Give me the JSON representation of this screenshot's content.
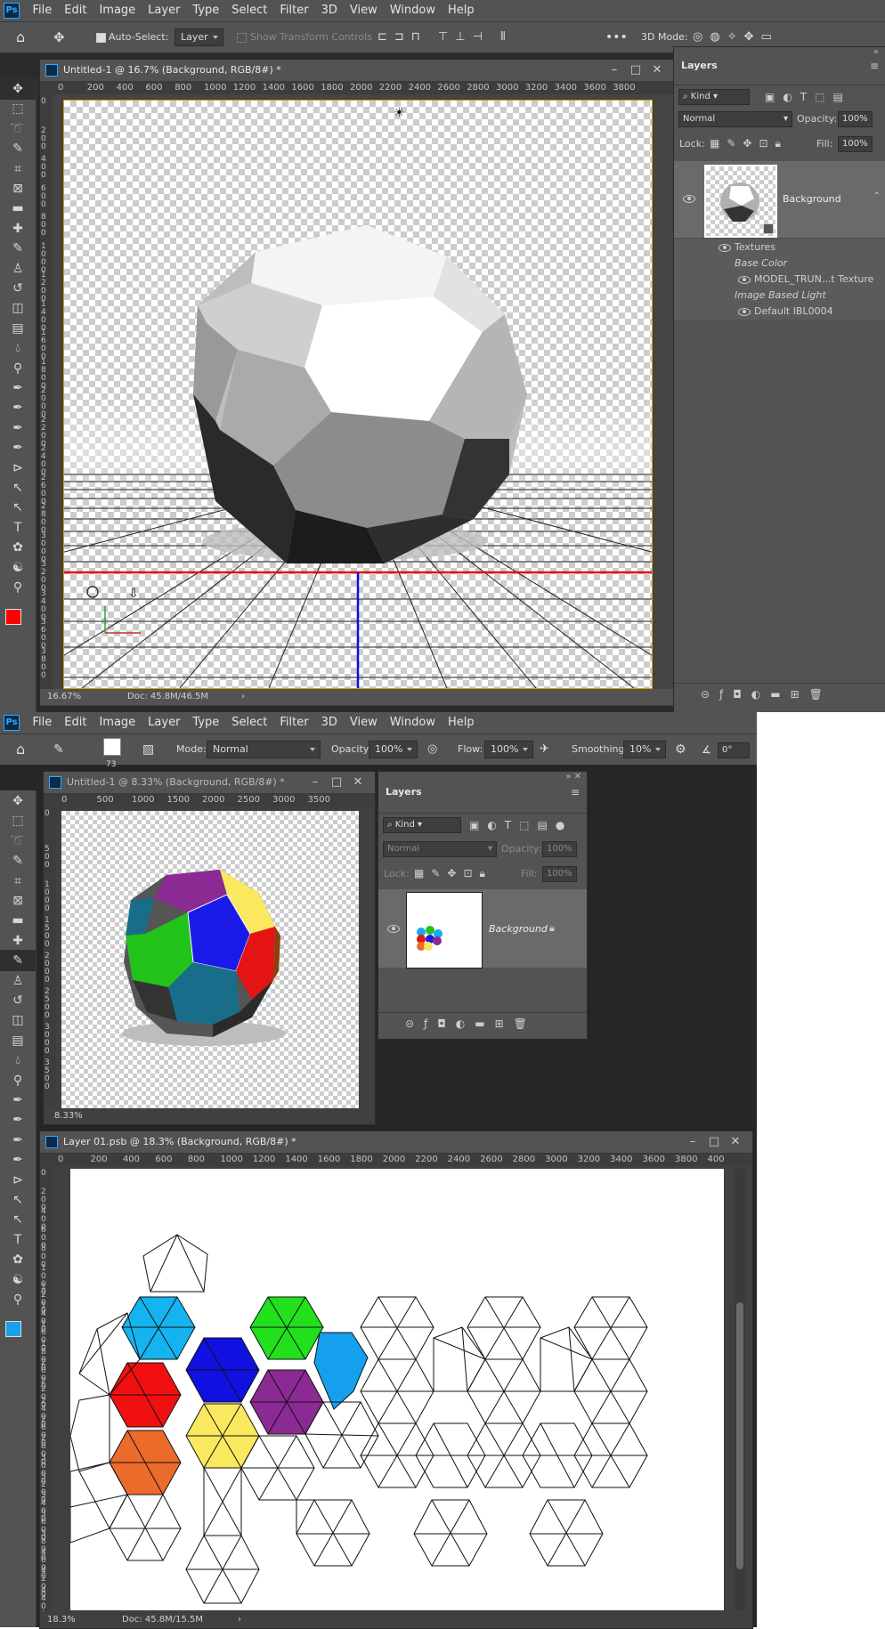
{
  "window1": {
    "menu": [
      "File",
      "Edit",
      "Image",
      "Layer",
      "Type",
      "Select",
      "Filter",
      "3D",
      "View",
      "Window",
      "Help"
    ],
    "options": {
      "auto_select_label": "Auto-Select:",
      "auto_select_value": "Layer",
      "show_transform_label": "Show Transform Controls",
      "mode_3d_label": "3D Mode:"
    },
    "doc": {
      "title": "Untitled-1 @ 16.7% (Background, RGB/8#) *",
      "ruler_h": [
        "0",
        "200",
        "400",
        "600",
        "800",
        "1000",
        "1200",
        "1400",
        "1600",
        "1800",
        "2000",
        "2200",
        "2400",
        "2600",
        "2800",
        "3000",
        "3200",
        "3400",
        "3600",
        "3800"
      ],
      "ruler_v": [
        "0",
        "200",
        "400",
        "600",
        "800",
        "1000",
        "1200",
        "1400",
        "1600",
        "1800",
        "2000",
        "2200",
        "2400",
        "2600",
        "2800",
        "3000",
        "3200",
        "3400",
        "3600",
        "3800"
      ],
      "zoom": "16.67%",
      "doc_size": "Doc: 45.8M/46.5M"
    },
    "layers_panel": {
      "tab": "Layers",
      "kind": "Kind",
      "blend_mode": "Normal",
      "opacity_label": "Opacity:",
      "opacity_value": "100%",
      "lock_label": "Lock:",
      "fill_label": "Fill:",
      "fill_value": "100%",
      "layer_name": "Background",
      "sub": {
        "textures": "Textures",
        "base_color": "Base Color",
        "texture_item": "MODEL_TRUN...t Texture",
        "ibl": "Image Based Light",
        "ibl_item": "Default IBL0004"
      }
    }
  },
  "window2": {
    "menu": [
      "File",
      "Edit",
      "Image",
      "Layer",
      "Type",
      "Select",
      "Filter",
      "3D",
      "View",
      "Window",
      "Help"
    ],
    "options": {
      "brush_size": "73",
      "mode_label": "Mode:",
      "mode_value": "Normal",
      "opacity_label": "Opacity:",
      "opacity_value": "100%",
      "flow_label": "Flow:",
      "flow_value": "100%",
      "smoothing_label": "Smoothing:",
      "smoothing_value": "10%",
      "angle_value": "0°"
    },
    "doc": {
      "title": "Untitled-1 @ 8.33% (Background, RGB/8#) *",
      "ruler_h": [
        "0",
        "500",
        "1000",
        "1500",
        "2000",
        "2500",
        "3000",
        "3500"
      ],
      "ruler_v": [
        "0",
        "500",
        "1000",
        "1500",
        "2000",
        "2500",
        "3000",
        "3500"
      ],
      "zoom": "8.33%"
    },
    "layers_panel": {
      "tab": "Layers",
      "kind": "Kind",
      "blend_mode": "Normal",
      "opacity_label": "Opacity:",
      "opacity_value": "100%",
      "lock_label": "Lock:",
      "fill_label": "Fill:",
      "fill_value": "100%",
      "layer_name": "Background"
    },
    "psb_doc": {
      "title": "Layer 01.psb @ 18.3% (Background, RGB/8#) *",
      "ruler_h": [
        "0",
        "200",
        "400",
        "600",
        "800",
        "1000",
        "1200",
        "1400",
        "1600",
        "1800",
        "2000",
        "2200",
        "2400",
        "2600",
        "2800",
        "3000",
        "3200",
        "3400",
        "3600",
        "3800",
        "400"
      ],
      "ruler_v": [
        "0",
        "200",
        "400",
        "600",
        "800",
        "1000",
        "1200",
        "1400",
        "1600",
        "1800",
        "2000",
        "2200",
        "2400",
        "2600",
        "2800",
        "3000",
        "3200",
        "3400",
        "3600",
        "3800",
        "4000",
        "4200",
        "4400"
      ],
      "zoom": "18.3%",
      "doc_size": "Doc: 45.8M/15.5M"
    }
  },
  "colors": {
    "red_face": "#e41414",
    "green_face": "#22c41c",
    "blue_face": "#1a1ae8",
    "purple_face": "#8a2a92",
    "yellow_face": "#fae95e",
    "cyan_face": "#14aaee",
    "orange_face": "#ec6a2a",
    "teal_face": "#186e8a",
    "brown_face": "#8a4010",
    "foreground_red": "#ff0000",
    "foreground_cyan": "#1aa0e8"
  }
}
